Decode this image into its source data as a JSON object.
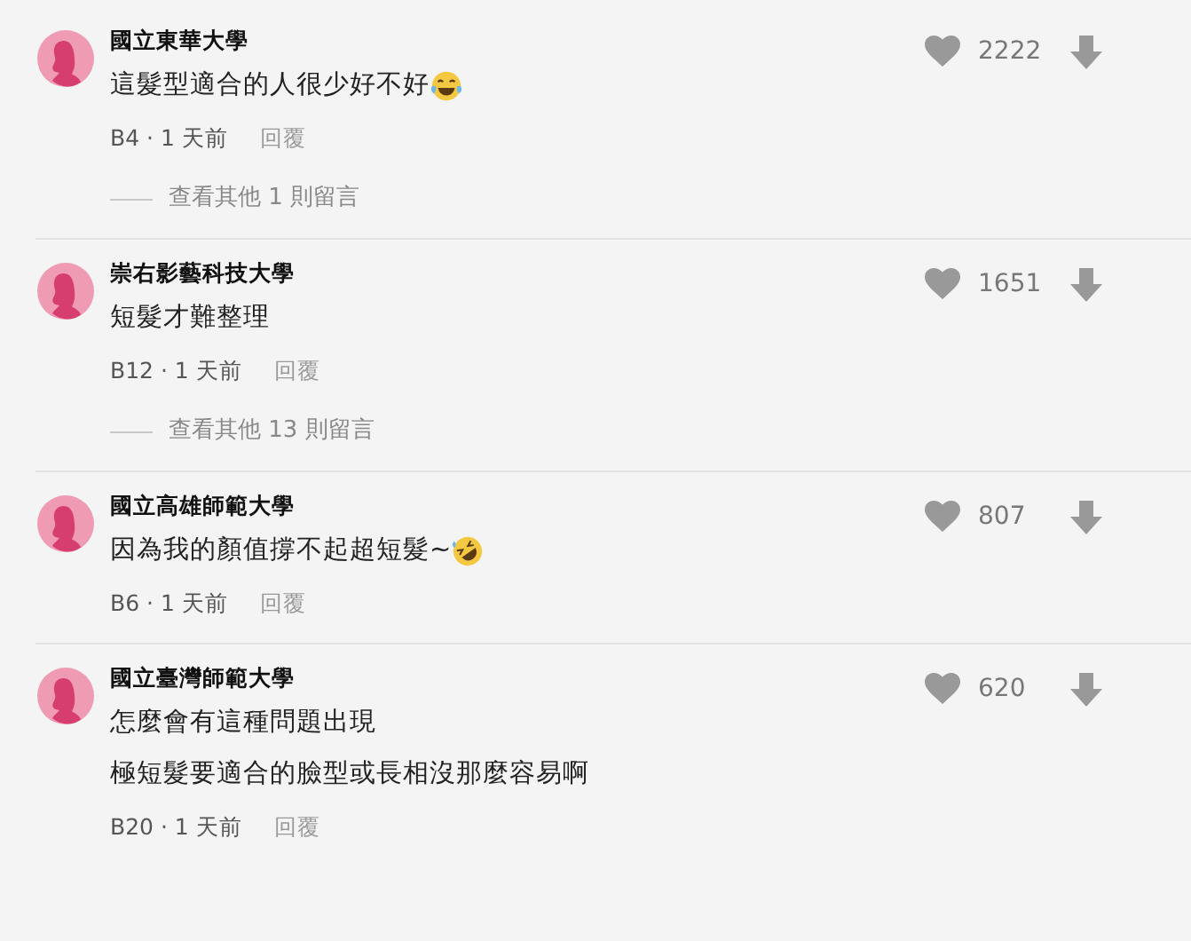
{
  "comments": [
    {
      "kind": "laughing",
      "author": "國立東華大學",
      "lines": [
        "這髮型適合的人很少好不好"
      ],
      "likes": "2222",
      "meta": "B4 · 1 天前",
      "reply": "回覆",
      "more_replies": "查看其他 1 則留言"
    },
    {
      "kind": "plain",
      "author": "崇右影藝科技大學",
      "lines": [
        "短髮才難整理"
      ],
      "likes": "1651",
      "meta": "B12 · 1 天前",
      "reply": "回覆",
      "more_replies": "查看其他 13 則留言"
    },
    {
      "kind": "rolling",
      "author": "國立高雄師範大學",
      "lines": [
        "因為我的顏值撐不起超短髮~"
      ],
      "likes": "807",
      "meta": "B6 · 1 天前",
      "reply": "回覆"
    },
    {
      "kind": "plain",
      "author": "國立臺灣師範大學",
      "lines": [
        "怎麼會有這種問題出現",
        "極短髮要適合的臉型或長相沒那麼容易啊"
      ],
      "likes": "620",
      "meta": "B20 · 1 天前",
      "reply": "回覆"
    }
  ]
}
